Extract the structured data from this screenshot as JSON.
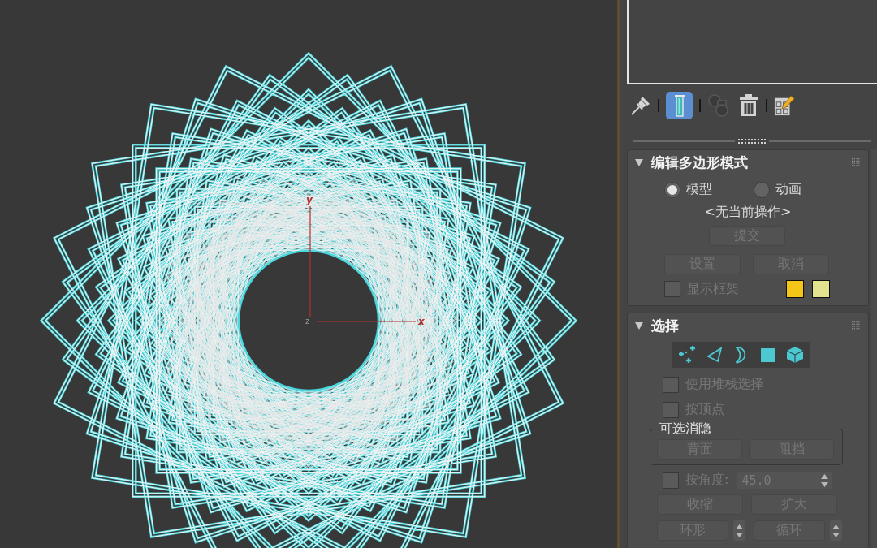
{
  "viewport": {
    "gizmo_labels": {
      "y": "y",
      "z": "z",
      "x": "x"
    }
  },
  "stack_toolbar": [
    {
      "kind": "pin",
      "on": false,
      "disabled": false
    },
    {
      "kind": "separator"
    },
    {
      "kind": "show-end-result",
      "on": true,
      "disabled": false
    },
    {
      "kind": "separator"
    },
    {
      "kind": "make-unique",
      "on": false,
      "disabled": true
    },
    {
      "kind": "remove-modifier",
      "on": false,
      "disabled": false
    },
    {
      "kind": "separator"
    },
    {
      "kind": "configure-sets",
      "on": false,
      "disabled": false
    }
  ],
  "edit_poly_mode": {
    "title": "编辑多边形模式",
    "expanded": true,
    "modes": [
      {
        "label": "模型",
        "selected": true
      },
      {
        "label": "动画",
        "selected": false
      }
    ],
    "current_operation": "<无当前操作>",
    "commit": {
      "label": "提交",
      "disabled": true
    },
    "buttons": [
      {
        "label": "设置",
        "disabled": true
      },
      {
        "label": "取消",
        "disabled": true
      }
    ],
    "show_cage": {
      "label": "显示框架",
      "checked": false,
      "disabled": true
    },
    "cage_colors": [
      {
        "color": "#f5c518"
      },
      {
        "color": "#e3e38f"
      }
    ]
  },
  "selection": {
    "title": "选择",
    "expanded": true,
    "subobjects": [
      {
        "kind": "vertex",
        "selected": false
      },
      {
        "kind": "edge",
        "selected": false
      },
      {
        "kind": "border",
        "selected": false
      },
      {
        "kind": "polygon",
        "selected": false
      },
      {
        "kind": "element",
        "selected": false
      }
    ],
    "options": [
      {
        "label": "使用堆栈选择",
        "checked": false,
        "disabled": true
      },
      {
        "label": "按顶点",
        "checked": false,
        "disabled": true
      }
    ],
    "culling": {
      "title": "可选消隐",
      "buttons": [
        {
          "label": "背面",
          "disabled": true
        },
        {
          "label": "阻挡",
          "disabled": true
        }
      ]
    },
    "by_angle": {
      "label": "按角度:",
      "checked": false,
      "disabled": true,
      "value": "45.0"
    },
    "grow_shrink": [
      {
        "label": "收缩",
        "disabled": true
      },
      {
        "label": "扩大",
        "disabled": true
      }
    ],
    "ring_loop": [
      {
        "label": "环形",
        "disabled": true
      },
      {
        "label": "循环",
        "disabled": true
      }
    ]
  }
}
